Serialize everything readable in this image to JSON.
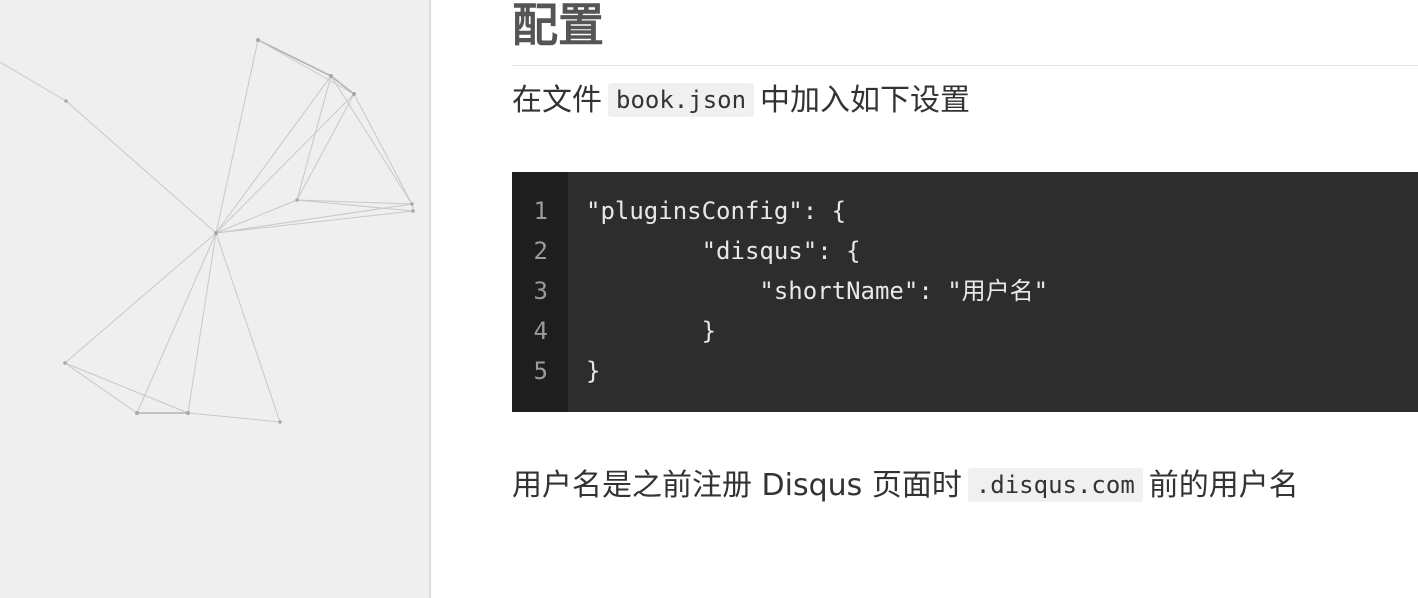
{
  "sidebar": {
    "network_decoration": "network-lines-background"
  },
  "main": {
    "heading": "配置",
    "intro": {
      "before": "在文件",
      "code": "book.json",
      "after": "中加入如下设置"
    },
    "code_block": {
      "line_numbers": [
        "1",
        "2",
        "3",
        "4",
        "5"
      ],
      "lines": [
        "\"pluginsConfig\": {",
        "        \"disqus\": {",
        "            \"shortName\": \"用户名\"",
        "        }",
        "}"
      ]
    },
    "note": {
      "before": "用户名是之前注册 Disqus 页面时",
      "code": ".disqus.com",
      "after": "前的用户名"
    }
  },
  "colors": {
    "sidebar_bg": "#efefef",
    "code_bg": "#2d2d2d",
    "gutter_bg": "#1e1e1e",
    "heading": "#555555",
    "text": "#333333"
  }
}
